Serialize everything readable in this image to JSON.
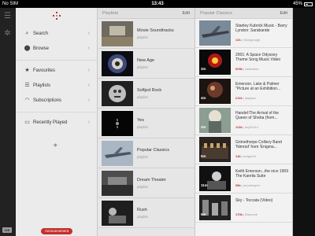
{
  "status": {
    "carrier": "No SIM",
    "time": "13:43",
    "battery": "45%"
  },
  "nav": {
    "items": [
      {
        "id": "search",
        "label": "Search",
        "icon": "search-icon",
        "glyph": "⌕"
      },
      {
        "id": "browse",
        "label": "Browse",
        "icon": "browse-icon",
        "glyph": "⬤"
      },
      {
        "id": "favourites",
        "label": "Favourites",
        "icon": "star-icon",
        "glyph": "★"
      },
      {
        "id": "playlists",
        "label": "Playlists",
        "icon": "playlist-icon",
        "glyph": "☰"
      },
      {
        "id": "subscriptions",
        "label": "Subscriptions",
        "icon": "wifi-icon",
        "glyph": "◠"
      },
      {
        "id": "recently-played",
        "label": "Recently Played",
        "icon": "film-icon",
        "glyph": "▭"
      }
    ],
    "chevron": "›",
    "announcement": "Announcement",
    "ios_badge": "iOS"
  },
  "playlists_panel": {
    "title": "Playlists",
    "edit": "Edit",
    "items": [
      {
        "name": "Movie Soundtracks",
        "sub": "playlist"
      },
      {
        "name": "New Age",
        "sub": "playlist"
      },
      {
        "name": "Softjed Rock",
        "sub": "playlist"
      },
      {
        "name": "Yes",
        "sub": "playlist"
      },
      {
        "name": "Popular Classics",
        "sub": "playlist"
      },
      {
        "name": "Dream Theater",
        "sub": "playlist"
      },
      {
        "name": "Rush",
        "sub": "playlist"
      }
    ]
  },
  "videos_panel": {
    "title": "Popular Classics",
    "edit": "Edit",
    "items": [
      {
        "title": "Stanley Kubrick Music - Barry Lyndon: Sarabande",
        "duration": "",
        "views": "12k",
        "channel": "Glowgrough"
      },
      {
        "title": "2001: A Space Odyssey Theme Song Music Video",
        "duration": "3m",
        "views": "605k",
        "channel": "castname"
      },
      {
        "title": "Emerson, Lake & Palmer \"Picture at an Exhibition...",
        "duration": "4m",
        "views": "211k",
        "channel": "starjazz"
      },
      {
        "title": "Handel:The Arrival of the Queen of Sheba (from...",
        "duration": "3m",
        "views": "113k",
        "channel": "sky91414"
      },
      {
        "title": "Grimethorpe Colliery Band 'Nimrod' from 'Enigma...",
        "duration": "5m",
        "views": "14k",
        "channel": "rudgerell"
      },
      {
        "title": "Keith Emerson...the nice 1969 The Karelia Suite",
        "duration": "11m",
        "views": "98k",
        "channel": "noonesuper"
      },
      {
        "title": "Sky - Toccata (Video)",
        "duration": "5m",
        "views": "170k",
        "channel": "Bluerock"
      }
    ]
  }
}
